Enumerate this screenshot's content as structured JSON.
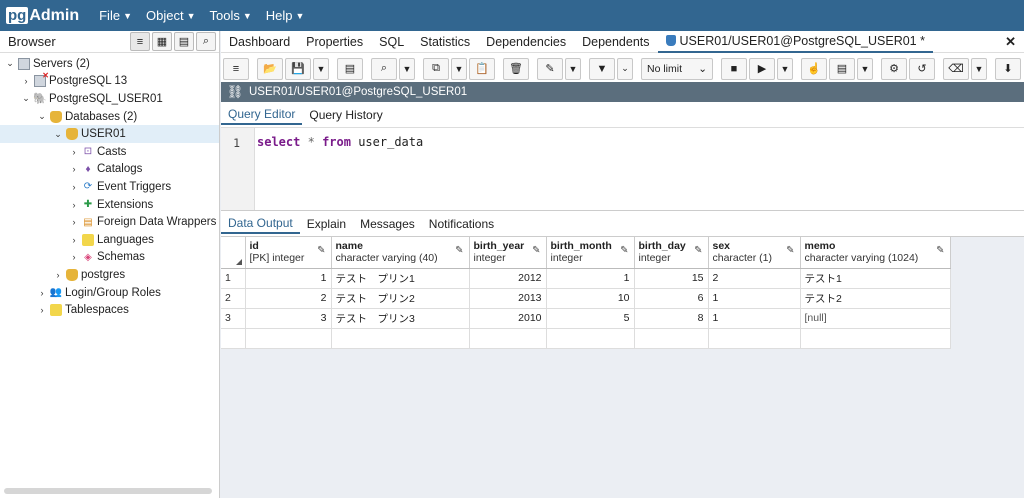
{
  "app": {
    "logo_pg": "pg",
    "logo_admin": "Admin"
  },
  "menu": [
    {
      "label": "File"
    },
    {
      "label": "Object"
    },
    {
      "label": "Tools"
    },
    {
      "label": "Help"
    }
  ],
  "browser": {
    "title": "Browser",
    "tree": {
      "servers": "Servers (2)",
      "pg13": "PostgreSQL 13",
      "pguser": "PostgreSQL_USER01",
      "databases": "Databases (2)",
      "user01": "USER01",
      "casts": "Casts",
      "catalogs": "Catalogs",
      "event_triggers": "Event Triggers",
      "extensions": "Extensions",
      "fdw": "Foreign Data Wrappers",
      "languages": "Languages",
      "schemas": "Schemas",
      "postgres": "postgres",
      "login_roles": "Login/Group Roles",
      "tablespaces": "Tablespaces"
    }
  },
  "tabs": {
    "dashboard": "Dashboard",
    "properties": "Properties",
    "sql": "SQL",
    "statistics": "Statistics",
    "dependencies": "Dependencies",
    "dependents": "Dependents",
    "query_tab": "USER01/USER01@PostgreSQL_USER01 *"
  },
  "toolbar": {
    "limit": "No limit"
  },
  "query": {
    "connection": "USER01/USER01@PostgreSQL_USER01",
    "editor_tab": "Query Editor",
    "history_tab": "Query History",
    "line_no": "1",
    "kw_select": "select",
    "star": "*",
    "kw_from": "from",
    "table": "user_data"
  },
  "output_tabs": {
    "data_output": "Data Output",
    "explain": "Explain",
    "messages": "Messages",
    "notifications": "Notifications"
  },
  "grid": {
    "columns": [
      {
        "name": "id",
        "type": "[PK] integer"
      },
      {
        "name": "name",
        "type": "character varying (40)"
      },
      {
        "name": "birth_year",
        "type": "integer"
      },
      {
        "name": "birth_month",
        "type": "integer"
      },
      {
        "name": "birth_day",
        "type": "integer"
      },
      {
        "name": "sex",
        "type": "character (1)"
      },
      {
        "name": "memo",
        "type": "character varying (1024)"
      }
    ],
    "rows": [
      {
        "n": "1",
        "id": "1",
        "name": "テスト　プリン1",
        "birth_year": "2012",
        "birth_month": "1",
        "birth_day": "15",
        "sex": "2",
        "memo": "テスト1"
      },
      {
        "n": "2",
        "id": "2",
        "name": "テスト　プリン2",
        "birth_year": "2013",
        "birth_month": "10",
        "birth_day": "6",
        "sex": "1",
        "memo": "テスト2"
      },
      {
        "n": "3",
        "id": "3",
        "name": "テスト　プリン3",
        "birth_year": "2010",
        "birth_month": "5",
        "birth_day": "8",
        "sex": "1",
        "memo": "[null]"
      }
    ]
  }
}
